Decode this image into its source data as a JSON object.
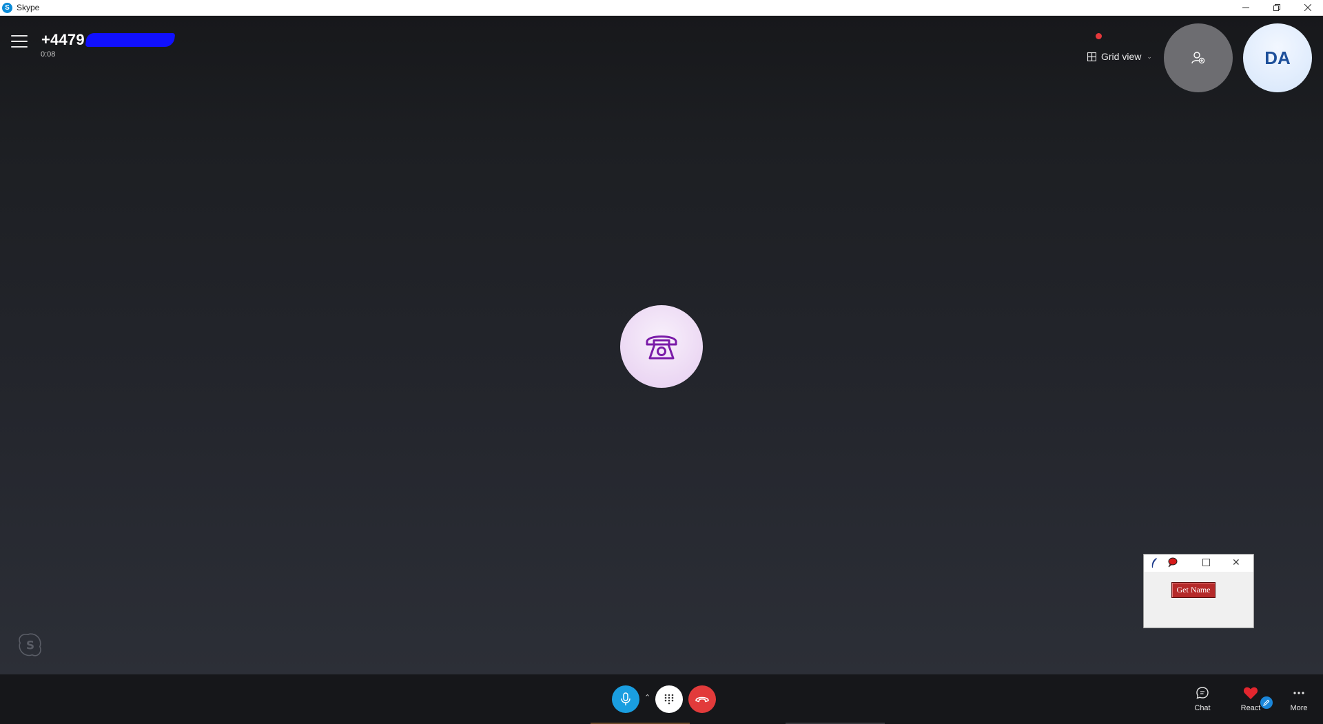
{
  "window": {
    "app_icon": "S",
    "title": "Skype",
    "controls": [
      "minimize-icon",
      "restore-icon",
      "close-icon"
    ]
  },
  "call": {
    "caller_visible": "+4479",
    "caller_redacted": true,
    "timer": "0:08",
    "recording_indicator_color": "#e5383b",
    "view_mode_label": "Grid view",
    "self_initials": "DA",
    "center_icon": "telephone-icon",
    "center_avatar_color": "#7a1ba8"
  },
  "mini_window": {
    "button_label": "Get Name",
    "button_color": "#b52a2a"
  },
  "controls": {
    "mic_color": "#1a9ee0",
    "end_call_color": "#e23b3b",
    "actions": [
      {
        "label": "Chat",
        "icon": "chat-icon"
      },
      {
        "label": "React",
        "icon": "heart-icon"
      },
      {
        "label": "More",
        "icon": "more-icon"
      }
    ]
  }
}
